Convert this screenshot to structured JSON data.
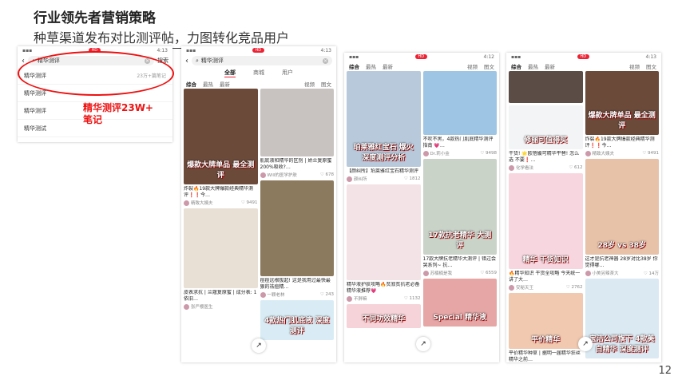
{
  "slide": {
    "title": "行业领先者营销策略",
    "subtitle": "种草渠道发布对比测评帖，力图转化竞品用户",
    "page": "12"
  },
  "annotation": {
    "line1": "精华测评23W+",
    "line2": "笔记"
  },
  "phone1": {
    "time": "4:13",
    "search": "精华测评",
    "search_btn": "搜索",
    "suggestions": [
      {
        "text": "精华测评",
        "count": "23万+篇笔记"
      },
      {
        "text": "精华测评 ",
        "count": ""
      },
      {
        "text": "精华测评 ",
        "count": ""
      },
      {
        "text": "精华测试",
        "count": ""
      }
    ]
  },
  "phone2": {
    "time": "4:13",
    "search": "精华测评",
    "tabs": [
      "全部",
      "商城",
      "用户"
    ],
    "filters": [
      "综合",
      "最热",
      "最新",
      "视频",
      "图文"
    ],
    "left": [
      {
        "overlay": "爆款大牌单品 最全测评",
        "title": "炸裂🔥19款大牌爆款经典精华测评❗❗今…",
        "author": "精致大姨夫",
        "likes": "9491",
        "color": "#6b4a3a",
        "h": 120
      },
      {
        "overlay": "",
        "title": "皮表求抗 | 兰蔻复原蜜 | 成分表: 1 依旧…",
        "author": "张严樱医生",
        "likes": "",
        "color": "#e8e0d4",
        "h": 100
      }
    ],
    "right": [
      {
        "overlay": "",
        "title": "肌底液和精华的区别 | 娇兰复原蜜200%吸收?…",
        "author": "Will的医学护肤",
        "likes": "678",
        "color": "#c8c3c0",
        "h": 85
      },
      {
        "overlay": "",
        "title": "痘痘远根拔起! 这是我用过最快最狠的祛痘精…",
        "author": "一颗老林",
        "likes": "243",
        "color": "#8c7a5e",
        "h": 120
      },
      {
        "overlay": "4款热门肌底液 深度测评",
        "title": "",
        "author": "",
        "likes": "",
        "color": "#d9ecf5",
        "h": 50
      }
    ]
  },
  "phone3": {
    "time": "4:12",
    "filters": [
      "综合",
      "最热",
      "最新",
      "视频",
      "图文"
    ],
    "left": [
      {
        "overlay": "珀莱雅红宝石 爆火 深度测评分析",
        "title": "【颜纠所】珀莱雅红宝石精华测评",
        "author": "颜纠所",
        "likes": "1812",
        "color": "#b7c9db",
        "h": 120
      },
      {
        "overlay": "",
        "title": "精华液护肤攻略🔥贫寂贫抗老必备精华液推荐💗",
        "author": "不胖嘛",
        "likes": "1132",
        "color": "#f3e3e6",
        "h": 120
      },
      {
        "overlay": "不同功效精华",
        "title": "",
        "author": "",
        "likes": "",
        "color": "#f6d3d8",
        "h": 30
      }
    ],
    "right": [
      {
        "overlay": "",
        "title": "不吹不黑，4款热门肌底精华测评指南 💗…",
        "author": "Dr.莉小金",
        "likes": "9498",
        "color": "#9ec6e4",
        "h": 80
      },
      {
        "overlay": "17款抗老精华 大测评",
        "title": "17款大牌抗老精华大测评 | 错过会哭系列~ 抗…",
        "author": "苏楠楠是我",
        "likes": "6559",
        "color": "#c9d3c8",
        "h": 120
      },
      {
        "overlay": "Special 精华液",
        "title": "",
        "author": "",
        "likes": "",
        "color": "#e6a6a6",
        "h": 60
      }
    ]
  },
  "phone4": {
    "time": "4:13",
    "filters": [
      "综合",
      "最热",
      "最新",
      "视频",
      "图文"
    ],
    "left": [
      {
        "overlay": "",
        "title": "",
        "author": "",
        "likes": "",
        "color": "#5b4c45",
        "h": 40
      },
      {
        "overlay": "修丽可值得买",
        "title": "干货! 🌟欧蓓媛可精华平替! 怎么选 不要❗…",
        "author": "化学看法",
        "likes": "612",
        "color": "#f3f4f6",
        "h": 55
      },
      {
        "overlay": "精华 干货知识",
        "title": "🔥精华知识 干货全攻略 今天统一讲了大…",
        "author": "安秘天王",
        "likes": "2762",
        "color": "#f7d6df",
        "h": 120
      },
      {
        "overlay": "平价精华",
        "title": "平价精华种草 | 据明一届精华狂丝精华之前…",
        "author": "",
        "likes": "",
        "color": "#f0c9b0",
        "h": 70
      }
    ],
    "right": [
      {
        "overlay": "爆款大牌单品 最全测评",
        "title": "炸裂🔥19款大牌爆款经典精华测评❗❗今…",
        "author": "精致大姨夫",
        "likes": "9491",
        "color": "#6b4a3a",
        "h": 80
      },
      {
        "overlay": "28岁 vs 38岁",
        "title": "这才是抗老神器 28岁对比38岁 你觉得哪…",
        "author": "小美另辣茶大",
        "likes": "14万",
        "color": "#e7c1a8",
        "h": 120
      },
      {
        "overlay": "宝洁公司旗下 4款美白精华 深度测评",
        "title": "",
        "author": "",
        "likes": "",
        "color": "#dbe9f3",
        "h": 100
      }
    ]
  }
}
